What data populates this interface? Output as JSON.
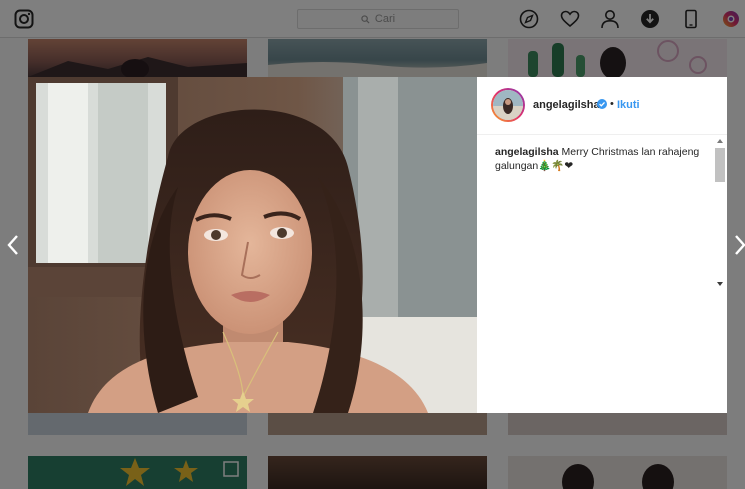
{
  "search": {
    "placeholder": "Cari"
  },
  "nav_icons": [
    "explore-compass-icon",
    "activity-heart-icon",
    "profile-person-icon",
    "download-icon",
    "mobile-phone-icon",
    "browser-extension-icon"
  ],
  "post": {
    "username": "angelagilsha",
    "separator": "•",
    "follow_label": "Ikuti",
    "caption_user": "angelagilsha",
    "caption_text": " Merry Christmas lan rahajeng galungan🎄🌴❤"
  },
  "colors": {
    "accent": "#3897f0",
    "verified": "#3897f0",
    "overlay": "rgba(0,0,0,0.5)",
    "heart": "#ed4956"
  }
}
